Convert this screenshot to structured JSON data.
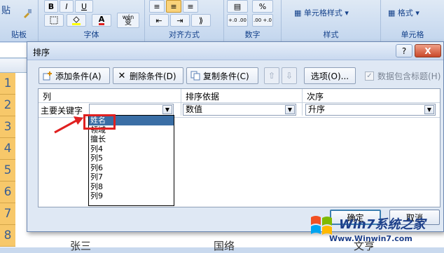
{
  "ribbon": {
    "groups": [
      "贴板",
      "字体",
      "对齐方式",
      "数字",
      "样式",
      "单元格"
    ],
    "paste_label": "贴",
    "format_brush_icon": "brush-icon",
    "font_buttons": [
      "B",
      "I",
      "U"
    ],
    "font_color_label": "A",
    "phonetic_label": "wén",
    "phonetic_sub": "变",
    "cell_style_label": "单元格样式",
    "format_label": "格式",
    "number_percent": "%",
    "number_decimals_1": "+.0 .00",
    "number_decimals_2": ".00 +.0"
  },
  "sheet": {
    "row_numbers": [
      "1",
      "2",
      "3",
      "4",
      "5",
      "6",
      "7",
      "8"
    ],
    "bottom_texts": [
      "张三",
      "国络",
      "文亨"
    ]
  },
  "dialog": {
    "title": "排序",
    "help_label": "?",
    "close_label": "X",
    "toolbar": {
      "add_label": "添加条件(A)",
      "delete_label": "删除条件(D)",
      "copy_label": "复制条件(C)",
      "up_arrow": "⇧",
      "down_arrow": "⇩",
      "options_label": "选项(O)...",
      "header_checkbox_label": "数据包含标题(H)",
      "header_checked": true
    },
    "grid": {
      "col_header": "列",
      "sort_on_header": "排序依据",
      "order_header": "次序",
      "primary_key_label": "主要关键字",
      "primary_key_value": "",
      "sort_on_value": "数值",
      "order_value": "升序"
    },
    "dropdown_items": [
      "姓名",
      "领域",
      "擅长",
      "列4",
      "列5",
      "列6",
      "列7",
      "列8",
      "列9"
    ],
    "selected_index": 0,
    "ok_label": "确定",
    "cancel_label": "取消"
  },
  "watermark": {
    "brand": "Win7系统之家",
    "url": "Www.Winwin7.com"
  },
  "colors": {
    "accent_red": "#e02020",
    "selection_blue": "#3a6ea5",
    "row_header_orange": "#f7c86a"
  }
}
